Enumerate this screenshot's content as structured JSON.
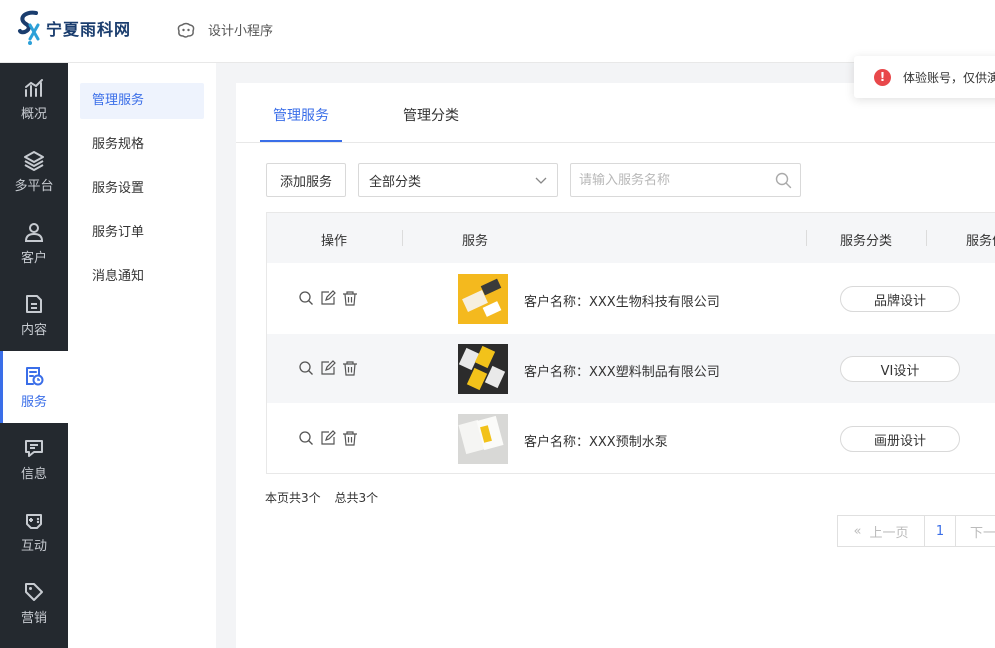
{
  "brand": {
    "logo_text": "宁夏雨科网",
    "mini_program_label": "设计小程序"
  },
  "toast": {
    "icon": "exclamation-icon",
    "message": "体验账号，仅供演示"
  },
  "leftnav": {
    "items": [
      {
        "label": "概况",
        "icon": "chart-icon"
      },
      {
        "label": "多平台",
        "icon": "layers-icon"
      },
      {
        "label": "客户",
        "icon": "user-icon"
      },
      {
        "label": "内容",
        "icon": "document-icon"
      },
      {
        "label": "服务",
        "icon": "service-icon",
        "active": true
      },
      {
        "label": "信息",
        "icon": "message-icon"
      },
      {
        "label": "互动",
        "icon": "gamepad-icon"
      },
      {
        "label": "营销",
        "icon": "tag-icon"
      }
    ]
  },
  "subnav": {
    "items": [
      {
        "label": "管理服务",
        "active": true
      },
      {
        "label": "服务规格"
      },
      {
        "label": "服务设置"
      },
      {
        "label": "服务订单"
      },
      {
        "label": "消息通知"
      }
    ]
  },
  "tabs": [
    {
      "label": "管理服务",
      "active": true
    },
    {
      "label": "管理分类"
    }
  ],
  "toolbar": {
    "add_button": "添加服务",
    "category_select": "全部分类",
    "search_placeholder": "请输入服务名称"
  },
  "table": {
    "columns": [
      "操作",
      "服务",
      "服务分类",
      "服务价格"
    ],
    "rows": [
      {
        "client": "客户名称：XXX生物科技有限公司",
        "category": "品牌设计"
      },
      {
        "client": "客户名称：XXX塑料制品有限公司",
        "category": "VI设计"
      },
      {
        "client": "客户名称：XXX预制水泵",
        "category": "画册设计"
      }
    ]
  },
  "summary": {
    "page_count": "本页共3个",
    "total_count": "总共3个"
  },
  "pagination": {
    "prev": "上一页",
    "current": "1",
    "next": "下一页"
  },
  "colors": {
    "accent": "#3a6ee8",
    "sidebar": "#24292f",
    "toast_icon": "#e8484b"
  }
}
